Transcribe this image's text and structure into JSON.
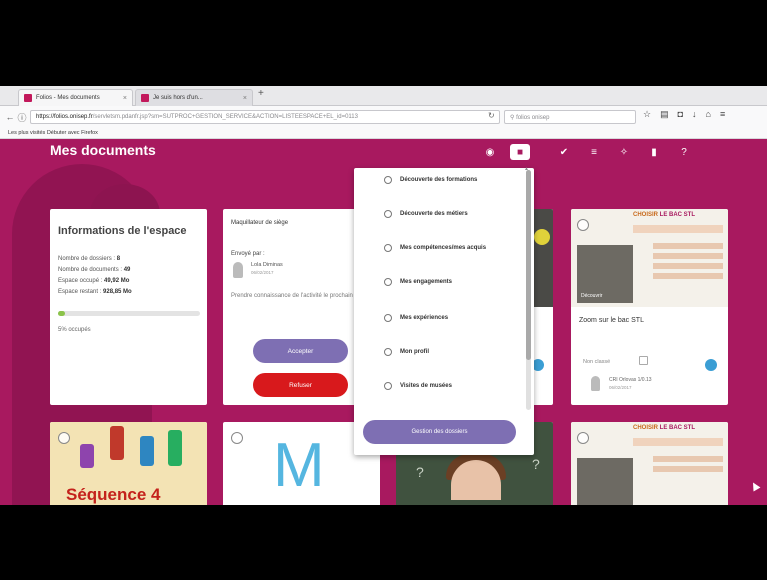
{
  "browser": {
    "tabs": [
      {
        "label": "Folios - Mes documents",
        "active": true
      },
      {
        "label": "Je suis hors d'un...",
        "active": false
      }
    ],
    "url_prefix": "https://folios.onisep.fr",
    "url_rest": "/servletsm.pdanfr.jsp?sm=SUTPROC+GESTION_SERVICE&ACTION=LISTEESPACE+EL_id=0113",
    "search_placeholder": "folios onisep",
    "bookmarks_text": "Les plus visités  Débuter avec Firefox"
  },
  "app": {
    "page_title": "Mes documents",
    "colors": {
      "brand": "#a8195f",
      "accent_purple": "#7e6fb3",
      "danger": "#d8191c",
      "progress": "#8bc34a",
      "info_blue": "#3b9ed4"
    }
  },
  "toolbar_icons": [
    "compass-icon",
    "folder-icon",
    "check-icon",
    "list-icon",
    "puzzle-icon",
    "file-icon",
    "help-icon"
  ],
  "info_card": {
    "title": "Informations de l'espace",
    "lines": [
      {
        "label": "Nombre de dossiers : ",
        "value": "8"
      },
      {
        "label": "Nombre de documents : ",
        "value": "49"
      },
      {
        "label": "Espace occupé : ",
        "value": "49,92 Mo"
      },
      {
        "label": "Espace restant : ",
        "value": "928,85 Mo"
      }
    ],
    "used_label": "5% occupés",
    "used_fraction": 0.05
  },
  "share_card": {
    "title": "Maquillateur de siège",
    "sent_by": "Envoyé par :",
    "sender": "Lola Diminas",
    "date": "06/02/2017",
    "message": "Prendre connaissance de l'activité le prochain cours.",
    "accept": "Accepter",
    "refuse": "Refuser"
  },
  "dropdown": {
    "items": [
      "Découverte des formations",
      "Découverte des métiers",
      "Mes compétences/mes acquis",
      "Mes engagements",
      "Mes expériences",
      "Mon profil",
      "Visites de musées"
    ],
    "manage_button": "Gestion des dossiers"
  },
  "poster_card": {
    "title_a": "CHOISIR ",
    "title_b": "LE BAC STL",
    "photo_label": "Découvrir",
    "zoom_title": "Zoom sur le bac STL",
    "non_classe": "Non classé",
    "sender": "CRI Orlovas 1/0.13",
    "date": "06/02/2017"
  },
  "sequence_card": {
    "text": "Séquence 4"
  },
  "m_card": {
    "letter": "M"
  },
  "chalk_card": {
    "glyph": "?"
  }
}
